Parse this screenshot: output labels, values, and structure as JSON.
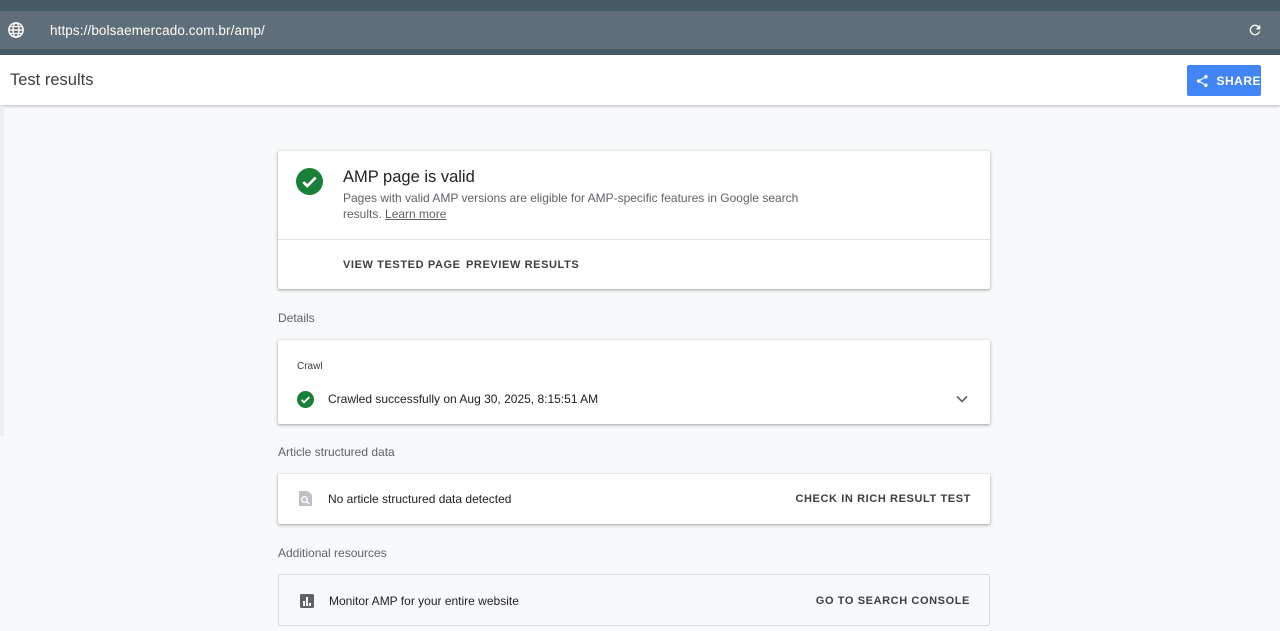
{
  "browser": {
    "url": "https://bolsaemercado.com.br/amp/",
    "globe_icon": "globe-icon",
    "reload_icon": "reload-icon"
  },
  "header": {
    "title": "Test results",
    "share_label": "SHARE",
    "share_icon": "share-icon"
  },
  "result": {
    "status_icon": "check-circle-icon",
    "title": "AMP page is valid",
    "description": "Pages with valid AMP versions are eligible for AMP-specific features in Google search results.",
    "learn_more": "Learn more",
    "actions": [
      "VIEW TESTED PAGE",
      "PREVIEW RESULTS"
    ]
  },
  "details": {
    "section_label": "Details",
    "crawl_label": "Crawl",
    "crawl_status": "Crawled successfully on Aug 30, 2025, 8:15:51 AM",
    "expand_icon": "chevron-down-icon"
  },
  "article": {
    "section_label": "Article structured data",
    "status": "No article structured data detected",
    "action": "CHECK IN RICH RESULT TEST"
  },
  "resources": {
    "section_label": "Additional resources",
    "item": "Monitor AMP for your entire website",
    "action": "GO TO SEARCH CONSOLE"
  },
  "colors": {
    "accent": "#4285f4",
    "success": "#188038",
    "url_bar": "#5f6e78",
    "chrome_dark": "#465a66"
  }
}
